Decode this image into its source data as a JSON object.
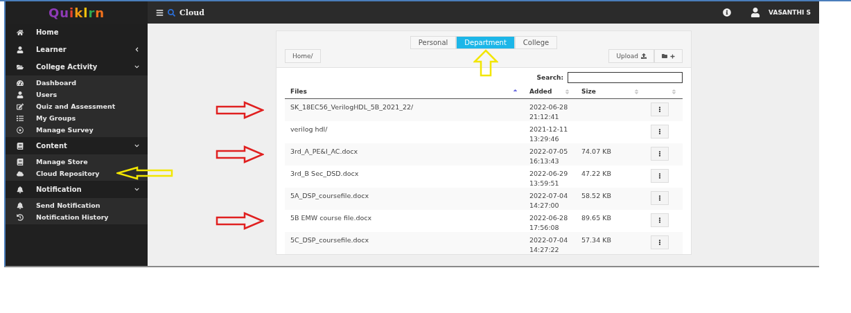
{
  "sidebar": {
    "logo": "Quiklrn",
    "items": [
      {
        "label": "Home"
      },
      {
        "label": "Learner",
        "expanded": false
      },
      {
        "label": "College Activity",
        "expanded": true,
        "children": [
          {
            "label": "Dashboard"
          },
          {
            "label": "Users"
          },
          {
            "label": "Quiz and Assessment"
          },
          {
            "label": "My Groups"
          },
          {
            "label": "Manage Survey"
          }
        ]
      },
      {
        "label": "Content",
        "expanded": true,
        "children": [
          {
            "label": "Manage Store"
          },
          {
            "label": "Cloud Repository",
            "arrow": true
          }
        ]
      },
      {
        "label": "Notification",
        "expanded": true,
        "children": [
          {
            "label": "Send Notification"
          },
          {
            "label": "Notification History"
          }
        ]
      }
    ]
  },
  "topbar": {
    "title": "Cloud",
    "user": "VASANTHI S"
  },
  "tabs": [
    {
      "label": "Personal",
      "selected": false
    },
    {
      "label": "Department",
      "selected": true,
      "arrow": true
    },
    {
      "label": "College",
      "selected": false
    }
  ],
  "breadcrumb": "Home/",
  "upload_button": "Upload",
  "search_label": "Search:",
  "table": {
    "columns": [
      {
        "label": "Files"
      },
      {
        "label": "Added"
      },
      {
        "label": "Size"
      }
    ],
    "rows": [
      {
        "name": "SK_18EC56_VerilogHDL_5B_2021_22/",
        "date": "2022-06-28",
        "time": "21:12:41",
        "arrow": true
      },
      {
        "name": "verilog hdl/",
        "date": "2021-12-11",
        "time": "13:29:46",
        "arrow": false
      },
      {
        "name": "3rd_A_PE&I_AC.docx",
        "date": "2022-07-05",
        "time": "16:13:43",
        "size": "74.07 KB",
        "arrow": true
      },
      {
        "name": "3rd_B Sec_DSD.docx",
        "date": "2022-06-29",
        "time": "13:59:51",
        "size": "47.22 KB",
        "arrow": false
      },
      {
        "name": "5A_DSP_coursefile.docx",
        "date": "2022-07-04",
        "time": "14:27:00",
        "size": "58.52 KB",
        "arrow": false
      },
      {
        "name": "5B EMW course file.docx",
        "date": "2022-06-28",
        "time": "17:56:08",
        "size": "89.65 KB",
        "arrow": true
      },
      {
        "name": "5C_DSP_coursefile.docx",
        "date": "2022-07-04",
        "time": "14:27:22",
        "size": "57.34 KB",
        "arrow": false
      }
    ]
  }
}
